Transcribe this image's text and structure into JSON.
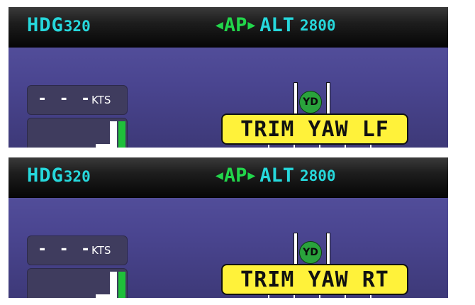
{
  "panels": [
    {
      "heading": {
        "label": "HDG",
        "value": "320"
      },
      "autopilot": {
        "left_arrow": "◀",
        "label": "AP",
        "right_arrow": "▶"
      },
      "altitude": {
        "label": "ALT",
        "value": "2800"
      },
      "airspeed": {
        "value": "- - -",
        "unit": "KTS"
      },
      "yaw_damper": {
        "label": "YD"
      },
      "trim_alert": {
        "text": "TRIM YAW LF"
      }
    },
    {
      "heading": {
        "label": "HDG",
        "value": "320"
      },
      "autopilot": {
        "left_arrow": "◀",
        "label": "AP",
        "right_arrow": "▶"
      },
      "altitude": {
        "label": "ALT",
        "value": "2800"
      },
      "airspeed": {
        "value": "- - -",
        "unit": "KTS"
      },
      "yaw_damper": {
        "label": "YD"
      },
      "trim_alert": {
        "text": "TRIM YAW RT"
      }
    }
  ],
  "colors": {
    "cyan": "#26d8dc",
    "green": "#22d64b",
    "alert_yellow": "#fff23a",
    "background_purple": "#4a4590"
  }
}
